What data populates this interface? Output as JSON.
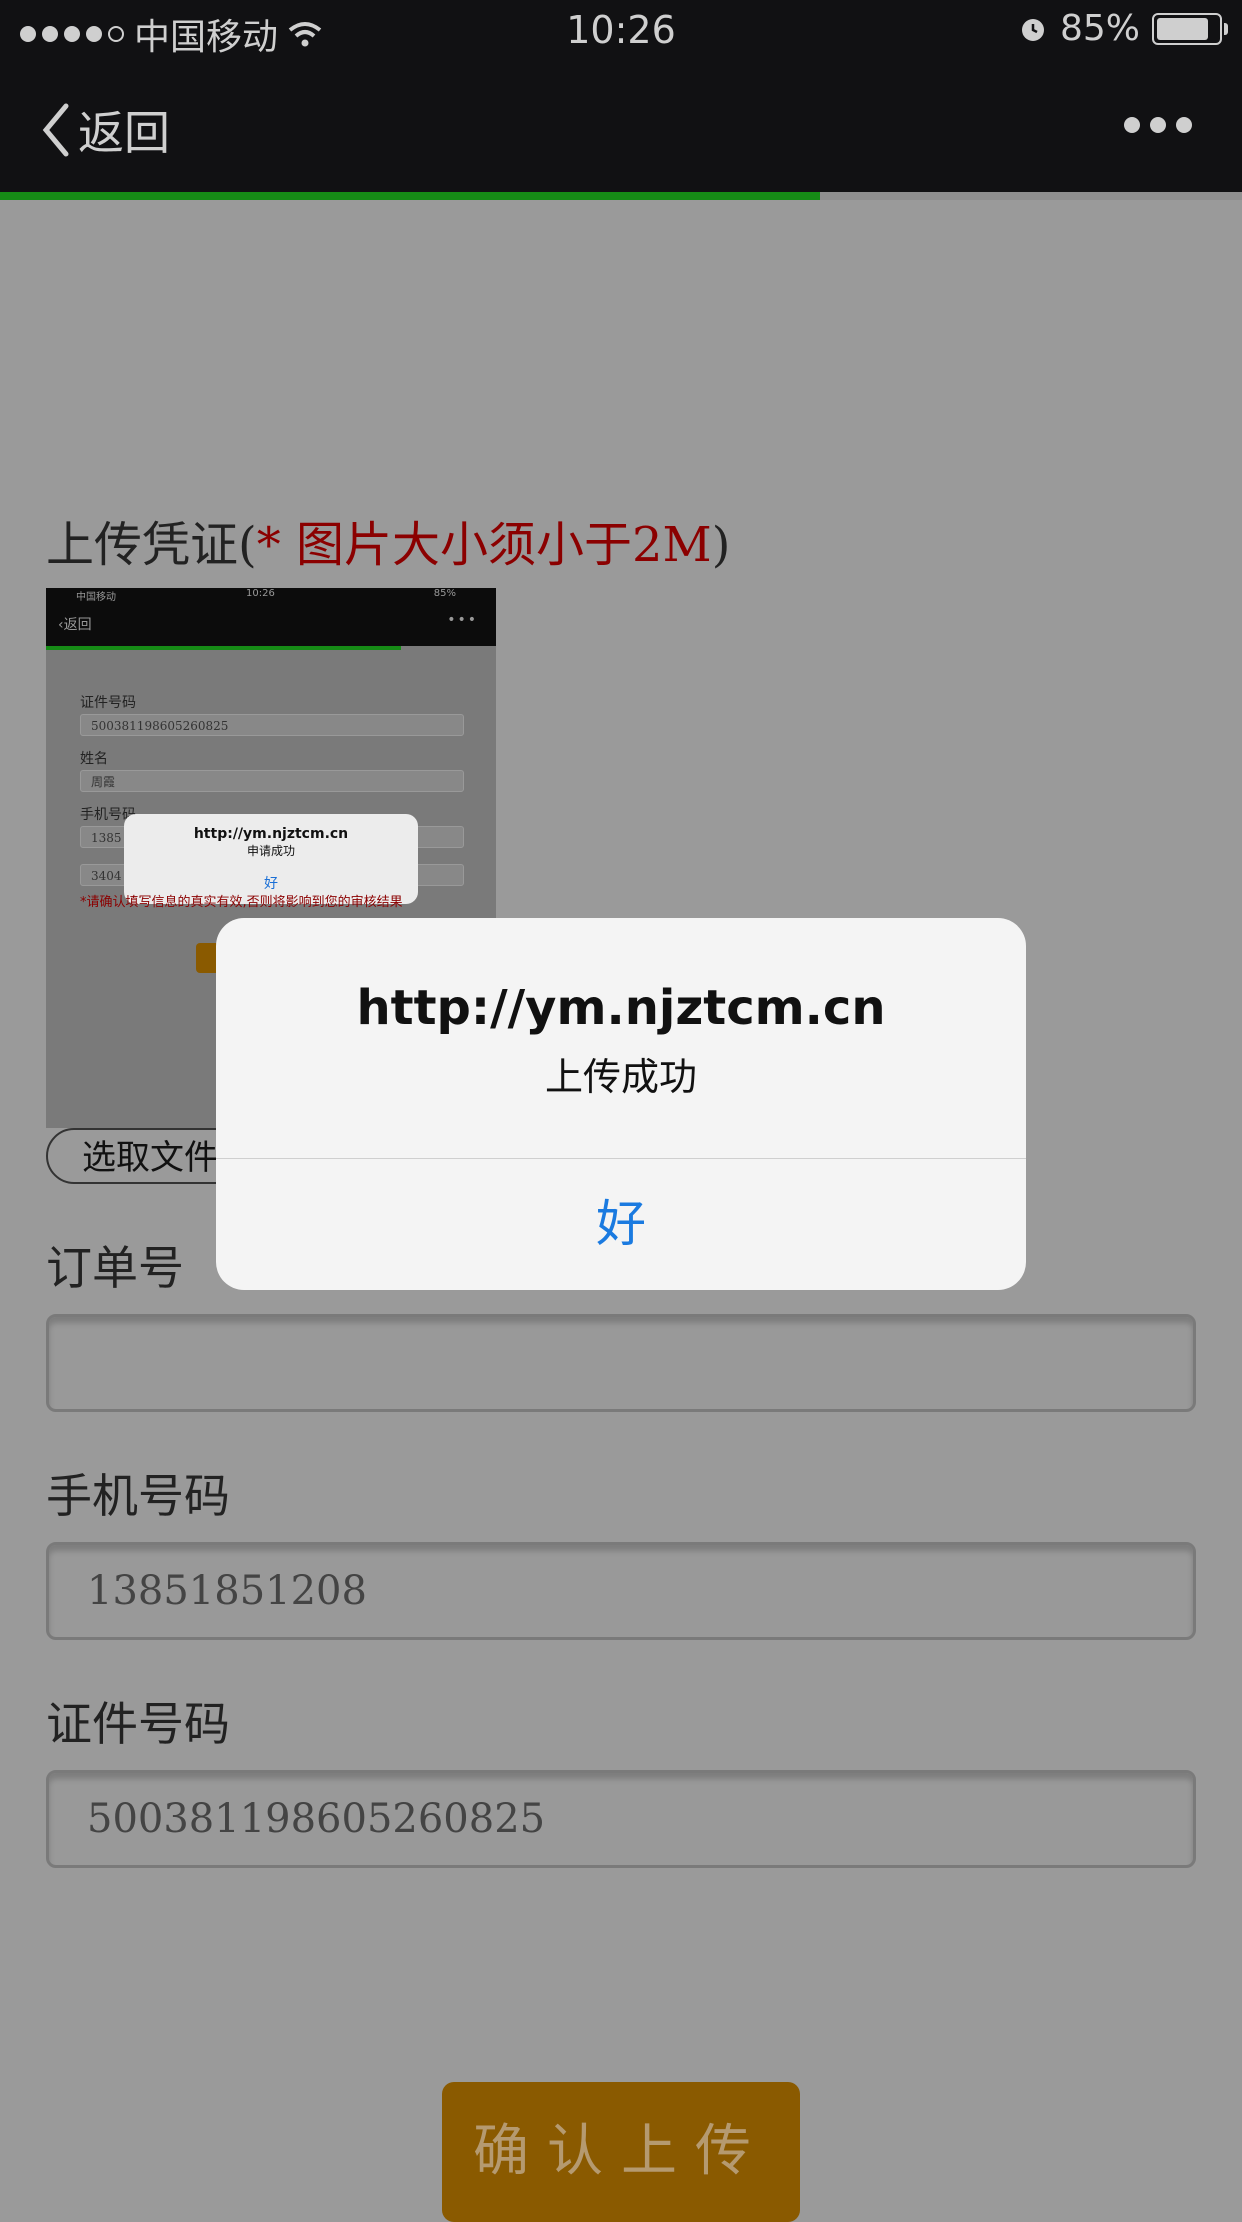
{
  "status_bar": {
    "carrier": "中国移动",
    "time": "10:26",
    "battery": "85%",
    "battery_level": 0.85
  },
  "nav": {
    "back_label": "返回",
    "progress": 0.66
  },
  "upload": {
    "title": "上传凭证",
    "warning": "图片大小须小于2M",
    "choose_file_label": "选取文件"
  },
  "thumbnail": {
    "carrier": "中国移动",
    "time": "10:26",
    "battery": "85%",
    "back_label": "返回",
    "id_label": "证件号码",
    "id_value": "500381198605260825",
    "name_label": "姓名",
    "name_value": "周霞",
    "phone_label": "手机号码",
    "phone_value": "1385",
    "code_value": "3404",
    "alert_title": "http://ym.njztcm.cn",
    "alert_message": "申请成功",
    "alert_ok": "好",
    "warning_text": "*请确认填写信息的真实有效,否则将影响到您的审核结果"
  },
  "form": {
    "order_label": "订单号",
    "order_value": "",
    "phone_label": "手机号码",
    "phone_value": "13851851208",
    "id_label": "证件号码",
    "id_value": "500381198605260825",
    "submit_label": "确认上传"
  },
  "alert": {
    "title": "http://ym.njztcm.cn",
    "message": "上传成功",
    "ok_label": "好"
  },
  "colors": {
    "accent_blue": "#1a7ae0",
    "progress_green": "#168b16",
    "warning_red": "#8b0000",
    "submit_brown": "#8a5a00"
  }
}
